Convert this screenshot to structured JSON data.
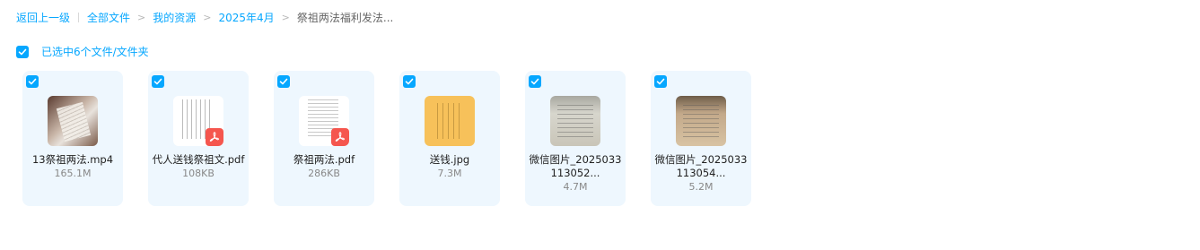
{
  "breadcrumb": {
    "back": "返回上一级",
    "items": [
      "全部文件",
      "我的资源",
      "2025年4月"
    ],
    "current": "祭祖两法福利发法..."
  },
  "selection": {
    "text": "已选中6个文件/文件夹"
  },
  "files": [
    {
      "name": "13祭祖两法.mp4",
      "size": "165.1M",
      "icon": "video-thumbnail"
    },
    {
      "name": "代人送钱祭祖文.pdf",
      "size": "108KB",
      "icon": "pdf-icon"
    },
    {
      "name": "祭祖两法.pdf",
      "size": "286KB",
      "icon": "pdf-icon"
    },
    {
      "name": "送钱.jpg",
      "size": "7.3M",
      "icon": "image-thumbnail"
    },
    {
      "name": "微信图片_2025033113052...",
      "size": "4.7M",
      "icon": "image-thumbnail"
    },
    {
      "name": "微信图片_2025033113054...",
      "size": "5.2M",
      "icon": "image-thumbnail"
    }
  ],
  "colors": {
    "accent": "#06a7ff",
    "card_bg": "#eef7fe",
    "pdf_red": "#f5564e"
  }
}
